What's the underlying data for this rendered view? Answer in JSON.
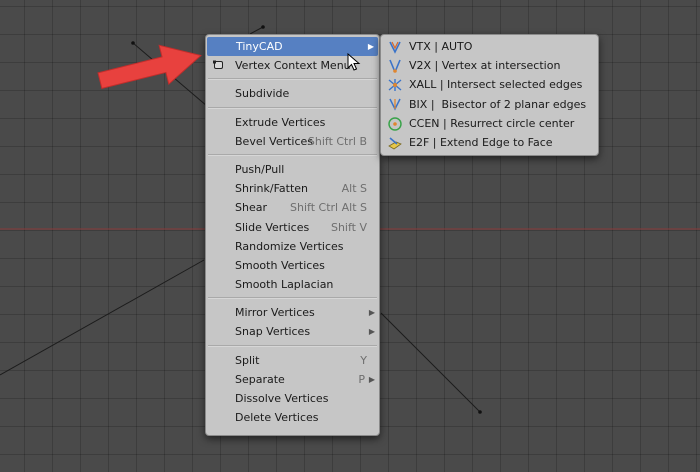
{
  "main_menu": {
    "groups": [
      [
        {
          "label": "TinyCAD",
          "shortcut": "",
          "submenu": true,
          "active": true,
          "icon": ""
        },
        {
          "label": "Vertex Context Menu",
          "shortcut": "",
          "submenu": false,
          "active": false,
          "icon": "menu-icon"
        }
      ],
      [
        {
          "label": "Subdivide",
          "shortcut": "",
          "submenu": false
        }
      ],
      [
        {
          "label": "Extrude Vertices",
          "shortcut": "",
          "submenu": false
        },
        {
          "label": "Bevel Vertices",
          "shortcut": "Shift Ctrl B",
          "submenu": false
        }
      ],
      [
        {
          "label": "Push/Pull",
          "shortcut": "",
          "submenu": false
        },
        {
          "label": "Shrink/Fatten",
          "shortcut": "Alt S",
          "submenu": false
        },
        {
          "label": "Shear",
          "shortcut": "Shift Ctrl Alt S",
          "submenu": false
        },
        {
          "label": "Slide Vertices",
          "shortcut": "Shift V",
          "submenu": false
        },
        {
          "label": "Randomize Vertices",
          "shortcut": "",
          "submenu": false
        },
        {
          "label": "Smooth Vertices",
          "shortcut": "",
          "submenu": false
        },
        {
          "label": "Smooth Laplacian",
          "shortcut": "",
          "submenu": false
        }
      ],
      [
        {
          "label": "Mirror Vertices",
          "shortcut": "",
          "submenu": true
        },
        {
          "label": "Snap Vertices",
          "shortcut": "",
          "submenu": true
        }
      ],
      [
        {
          "label": "Split",
          "shortcut": "Y",
          "submenu": false
        },
        {
          "label": "Separate",
          "shortcut": "P",
          "submenu": true
        },
        {
          "label": "Dissolve Vertices",
          "shortcut": "",
          "submenu": false
        },
        {
          "label": "Delete Vertices",
          "shortcut": "",
          "submenu": false
        }
      ]
    ]
  },
  "submenu": {
    "items": [
      {
        "label": "VTX | AUTO",
        "icon": "vtx-icon"
      },
      {
        "label": "V2X | Vertex at intersection",
        "icon": "v2x-icon"
      },
      {
        "label": "XALL | Intersect selected edges",
        "icon": "xall-icon"
      },
      {
        "label": "BIX |  Bisector of 2 planar edges",
        "icon": "bix-icon"
      },
      {
        "label": "CCEN | Resurrect circle center",
        "icon": "ccen-icon"
      },
      {
        "label": "E2F | Extend Edge to Face",
        "icon": "e2f-icon"
      }
    ]
  },
  "colors": {
    "viewport_bg": "#4a4a4a",
    "menu_bg": "#c6c6c6",
    "highlight": "#5680c2",
    "pointer_arrow": "#e8413e",
    "x_axis": "#8a3a3a"
  }
}
